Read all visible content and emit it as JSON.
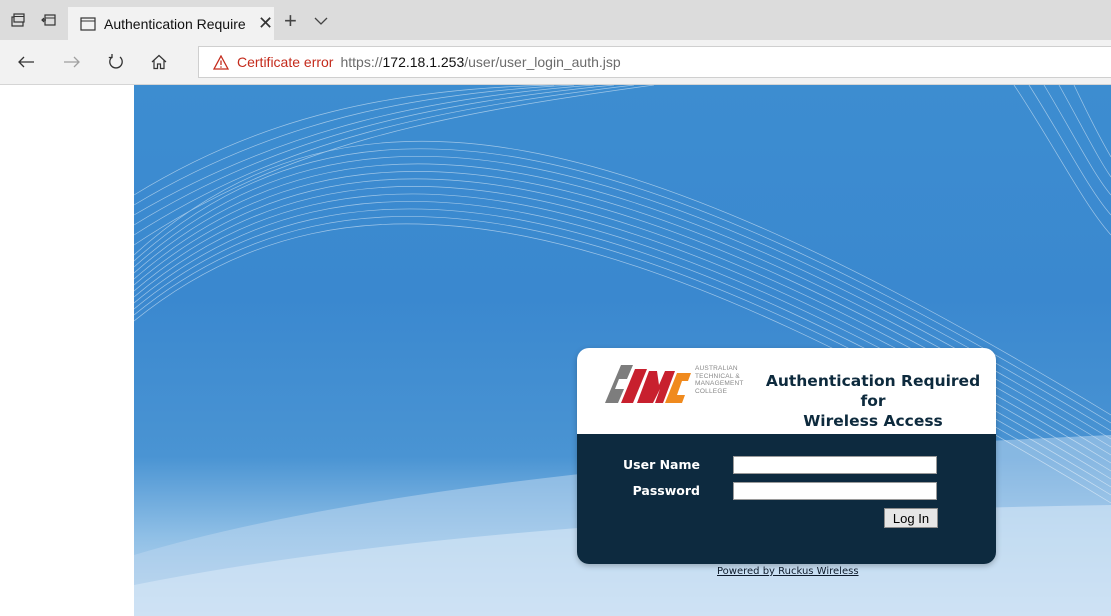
{
  "browser": {
    "tab": {
      "title": "Authentication Requirec",
      "close_label": "✕"
    },
    "new_tab_label": "+",
    "address": {
      "cert_error": "Certificate error",
      "url_scheme": "https://",
      "url_host": "172.18.1.253",
      "url_path": "/user/user_login_auth.jsp"
    }
  },
  "login": {
    "logo_text": [
      "AUSTRALIAN",
      "TECHNICAL &",
      "MANAGEMENT",
      "COLLEGE"
    ],
    "heading_line1": "Authentication Required for",
    "heading_line2": "Wireless Access",
    "username_label": "User Name",
    "password_label": "Password",
    "username_value": "",
    "password_value": "",
    "login_button": "Log In",
    "powered_by": "Powered by Ruckus Wireless"
  },
  "colors": {
    "panel_dark": "#0d2a3f",
    "logo_red": "#c8202e",
    "logo_orange": "#f08a1e",
    "logo_gray": "#7d7d7d",
    "cert_error": "#c42b1c"
  }
}
